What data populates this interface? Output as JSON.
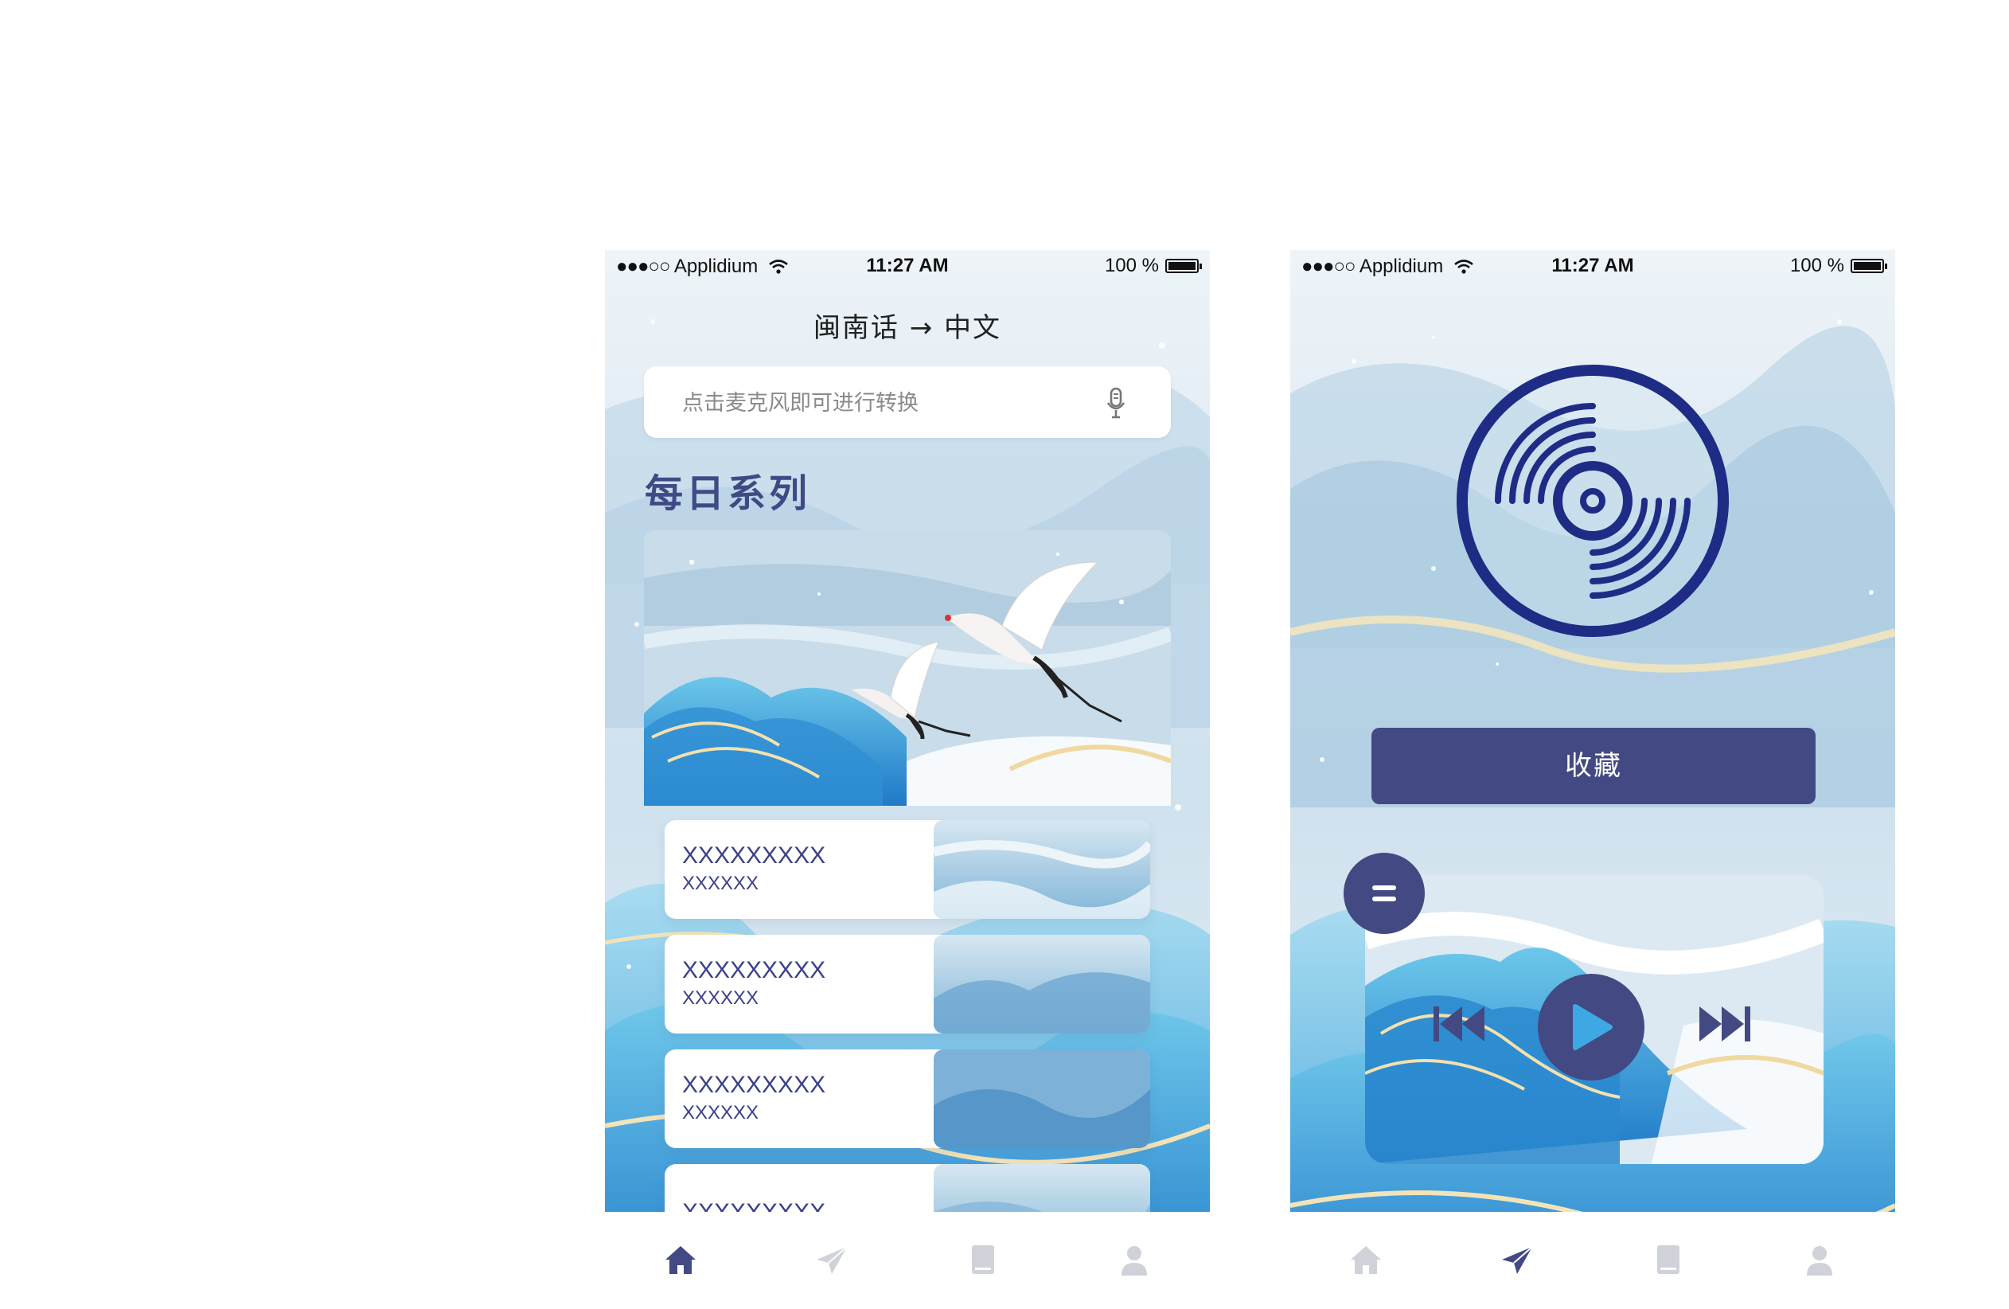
{
  "status_bar": {
    "carrier": "Applidium",
    "time": "11:27 AM",
    "battery": "100 %"
  },
  "screen_translate": {
    "header_title": "闽南话 → 中文",
    "search_placeholder": "点击麦克风即可进行转换",
    "section_title": "每日系列",
    "items": [
      {
        "title": "XXXXXXXXX",
        "subtitle": "XXXXXX"
      },
      {
        "title": "XXXXXXXXX",
        "subtitle": "XXXXXX"
      },
      {
        "title": "XXXXXXXXX",
        "subtitle": "XXXXXX"
      },
      {
        "title": "XXXXXXXXX",
        "subtitle": ""
      }
    ],
    "active_tab": "home"
  },
  "screen_player": {
    "collect_label": "收藏",
    "active_tab": "send"
  },
  "tabs": [
    "home-icon",
    "send-icon",
    "book-icon",
    "person-icon"
  ],
  "colors": {
    "accent": "#434983",
    "text_blue": "#3b4189",
    "tab_inactive": "#cfd2d8",
    "sky": "#dfeaf2",
    "mountain": "#3b9fd9"
  }
}
